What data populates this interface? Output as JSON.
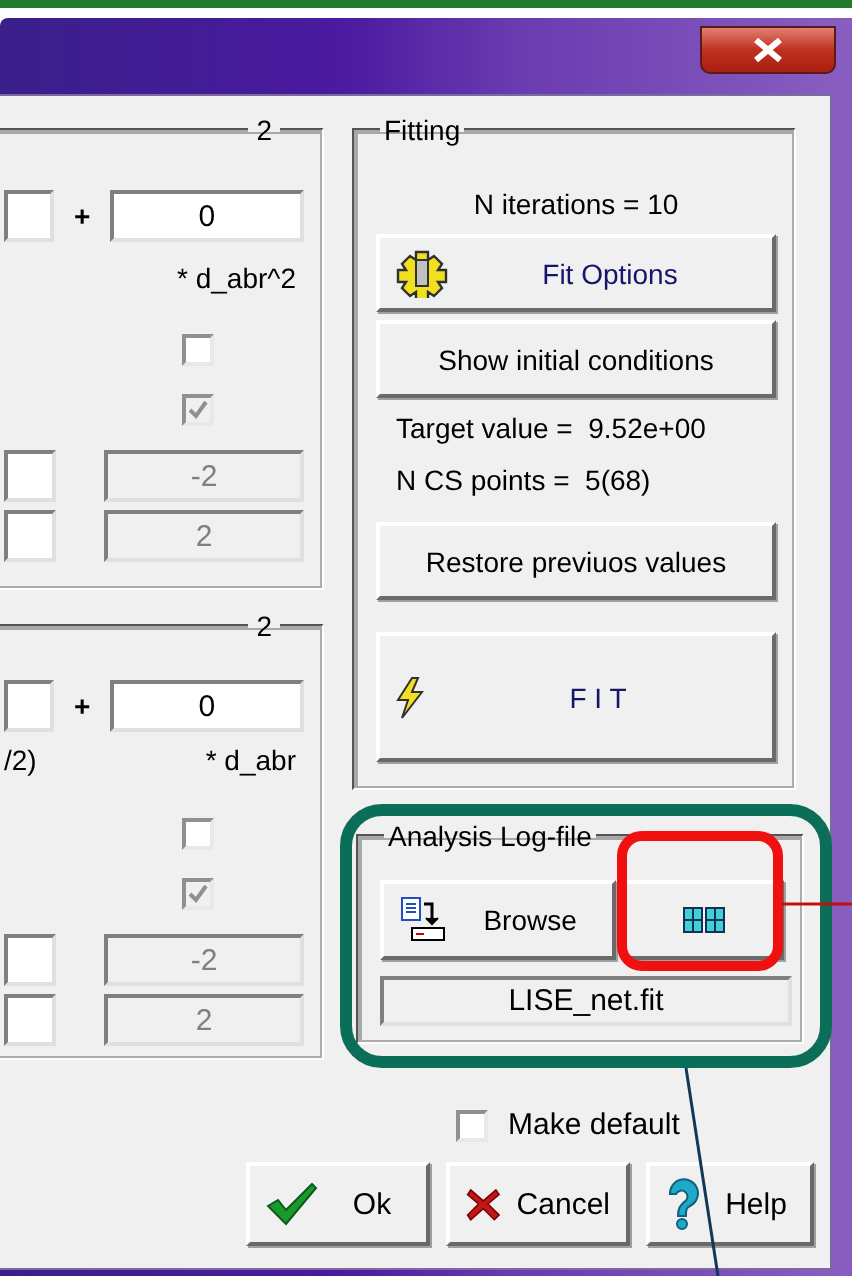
{
  "panels": [
    {
      "legend": "2",
      "plus": "+",
      "coefficient": "0",
      "term": "* d_abr^2",
      "checkboxes": [
        {
          "checked": false,
          "disabled": false
        },
        {
          "checked": true,
          "disabled": true
        }
      ],
      "limits": [
        {
          "value": "-2",
          "disabled": true
        },
        {
          "value": "2",
          "disabled": true
        }
      ]
    },
    {
      "legend": "2",
      "plus": "+",
      "coefficient": "0",
      "left_label": "/2)",
      "term": "* d_abr",
      "checkboxes": [
        {
          "checked": false,
          "disabled": false
        },
        {
          "checked": true,
          "disabled": true
        }
      ],
      "limits": [
        {
          "value": "-2",
          "disabled": true
        },
        {
          "value": "2",
          "disabled": true
        }
      ]
    }
  ],
  "fitting": {
    "legend": "Fitting",
    "items": [
      {
        "kind": "text",
        "text": "N iterations = 10"
      },
      {
        "kind": "gear_button",
        "text": "Fit Options"
      },
      {
        "kind": "button",
        "text": "Show initial conditions"
      },
      {
        "kind": "text",
        "text": "Target value =  9.52e+00"
      },
      {
        "kind": "text",
        "text": "N CS points =  5(68)"
      },
      {
        "kind": "button",
        "text": "Restore previuos values"
      },
      {
        "kind": "bolt_button",
        "text": "F I T"
      }
    ]
  },
  "log_file": {
    "legend": "Analysis Log-file",
    "browse": "Browse",
    "file": "LISE_net.fit"
  },
  "make_default": {
    "label": "Make default",
    "checked": false
  },
  "buttons": [
    {
      "kind": "ok",
      "label": "Ok"
    },
    {
      "kind": "cancel",
      "label": "Cancel"
    },
    {
      "kind": "help",
      "label": "Help"
    }
  ]
}
